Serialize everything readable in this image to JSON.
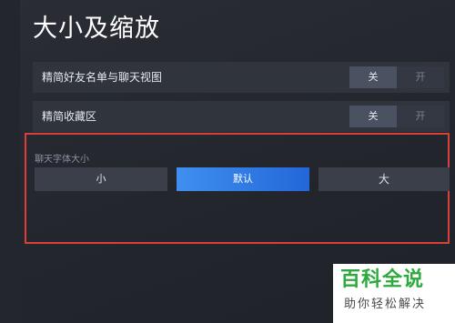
{
  "page": {
    "title": "大小及缩放"
  },
  "settings": [
    {
      "label": "精简好友名单与聊天视图",
      "toggle_on": "关",
      "toggle_off": "开"
    },
    {
      "label": "精简收藏区",
      "toggle_on": "关",
      "toggle_off": "开"
    }
  ],
  "font_size": {
    "label": "聊天字体大小",
    "options": [
      "小",
      "默认",
      "大"
    ],
    "selected": "默认"
  },
  "watermark": {
    "title": "百科全说",
    "subtitle": "助你轻松解决"
  },
  "colors": {
    "highlight_border": "#d9403a",
    "selected_button": "#2f7be6",
    "watermark_green": "#2eaa3c"
  }
}
